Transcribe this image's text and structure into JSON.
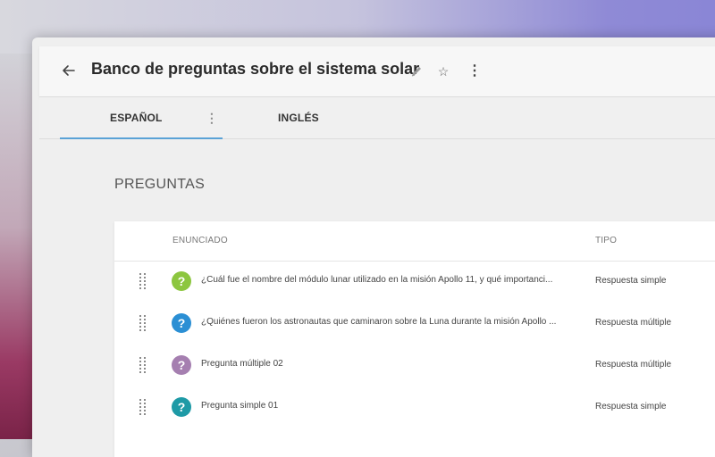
{
  "header": {
    "title": "Banco de preguntas sobre el sistema solar",
    "icons": [
      "back-arrow-icon",
      "pencil-icon",
      "star-icon",
      "more-vertical-icon"
    ]
  },
  "tabs": [
    {
      "label": "ESPAÑOL",
      "active": true
    },
    {
      "label": "INGLÉS",
      "active": false
    }
  ],
  "section": {
    "title": "PREGUNTAS"
  },
  "table": {
    "columns": [
      "ENUNCIADO",
      "TIPO"
    ],
    "rows": [
      {
        "text": "¿Cuál fue el nombre del módulo lunar utilizado en la misión Apollo 11, y qué importanci...",
        "type": "Respuesta simple",
        "icon_color": "#8cc63f"
      },
      {
        "text": "¿Quiénes fueron los astronautas que caminaron sobre la Luna durante la misión Apollo ...",
        "type": "Respuesta múltiple",
        "icon_color": "#2b8fd4"
      },
      {
        "text": "Pregunta múltiple 02",
        "type": "Respuesta múltiple",
        "icon_color": "#a57fb0"
      },
      {
        "text": "Pregunta simple 01",
        "type": "Respuesta simple",
        "icon_color": "#1e9aa6"
      }
    ]
  },
  "colors": {
    "accent": "#5aa2d6"
  }
}
